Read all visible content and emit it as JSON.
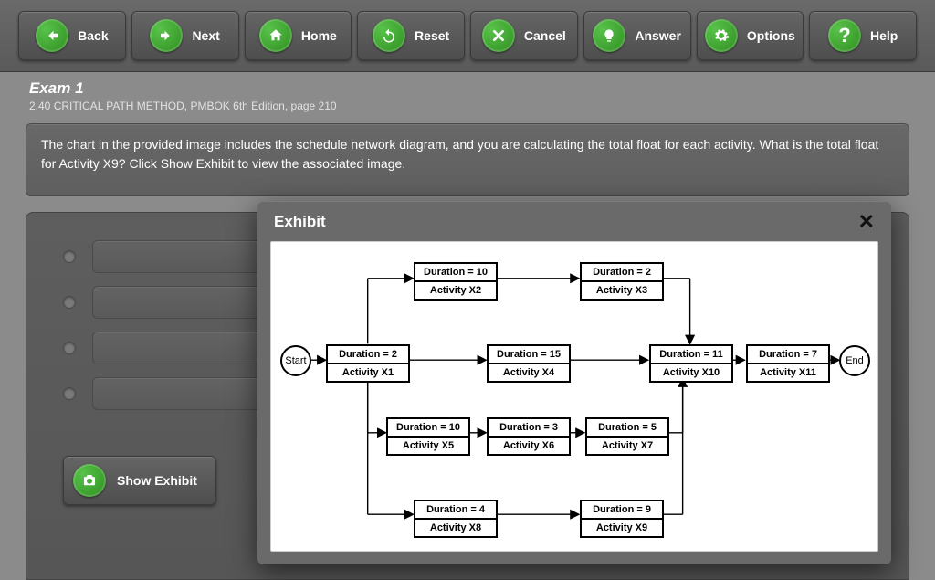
{
  "toolbar": {
    "back": "Back",
    "next": "Next",
    "home": "Home",
    "reset": "Reset",
    "cancel": "Cancel",
    "answer": "Answer",
    "options": "Options",
    "help": "Help"
  },
  "exam": {
    "title": "Exam 1",
    "subtitle": "2.40 CRITICAL PATH METHOD, PMBOK 6th Edition, page 210"
  },
  "question": "The chart in the provided image includes the schedule network diagram, and you are calculating the total float for each activity. What is the total float for Activity X9? Click Show Exhibit to view the associated image.",
  "options": [
    "",
    "",
    "",
    ""
  ],
  "show_exhibit_label": "Show Exhibit",
  "modal": {
    "title": "Exhibit",
    "start": "Start",
    "end": "End",
    "activities": {
      "x1": {
        "dur": "Duration = 2",
        "name": "Activity X1"
      },
      "x2": {
        "dur": "Duration = 10",
        "name": "Activity X2"
      },
      "x3": {
        "dur": "Duration = 2",
        "name": "Activity X3"
      },
      "x4": {
        "dur": "Duration = 15",
        "name": "Activity X4"
      },
      "x5": {
        "dur": "Duration = 10",
        "name": "Activity X5"
      },
      "x6": {
        "dur": "Duration = 3",
        "name": "Activity X6"
      },
      "x7": {
        "dur": "Duration = 5",
        "name": "Activity X7"
      },
      "x8": {
        "dur": "Duration = 4",
        "name": "Activity X8"
      },
      "x9": {
        "dur": "Duration = 9",
        "name": "Activity X9"
      },
      "x10": {
        "dur": "Duration = 11",
        "name": "Activity X10"
      },
      "x11": {
        "dur": "Duration = 7",
        "name": "Activity X11"
      }
    }
  },
  "chart_data": {
    "type": "network-diagram",
    "title": "Schedule Network Diagram",
    "nodes": [
      {
        "id": "Start",
        "type": "terminal"
      },
      {
        "id": "X1",
        "duration": 2
      },
      {
        "id": "X2",
        "duration": 10
      },
      {
        "id": "X3",
        "duration": 2
      },
      {
        "id": "X4",
        "duration": 15
      },
      {
        "id": "X5",
        "duration": 10
      },
      {
        "id": "X6",
        "duration": 3
      },
      {
        "id": "X7",
        "duration": 5
      },
      {
        "id": "X8",
        "duration": 4
      },
      {
        "id": "X9",
        "duration": 9
      },
      {
        "id": "X10",
        "duration": 11
      },
      {
        "id": "X11",
        "duration": 7
      },
      {
        "id": "End",
        "type": "terminal"
      }
    ],
    "edges": [
      [
        "Start",
        "X1"
      ],
      [
        "X1",
        "X2"
      ],
      [
        "X1",
        "X4"
      ],
      [
        "X1",
        "X5"
      ],
      [
        "X1",
        "X8"
      ],
      [
        "X2",
        "X3"
      ],
      [
        "X3",
        "X10"
      ],
      [
        "X4",
        "X10"
      ],
      [
        "X5",
        "X6"
      ],
      [
        "X6",
        "X7"
      ],
      [
        "X7",
        "X10"
      ],
      [
        "X8",
        "X9"
      ],
      [
        "X9",
        "X10"
      ],
      [
        "X10",
        "X11"
      ],
      [
        "X11",
        "End"
      ]
    ]
  }
}
